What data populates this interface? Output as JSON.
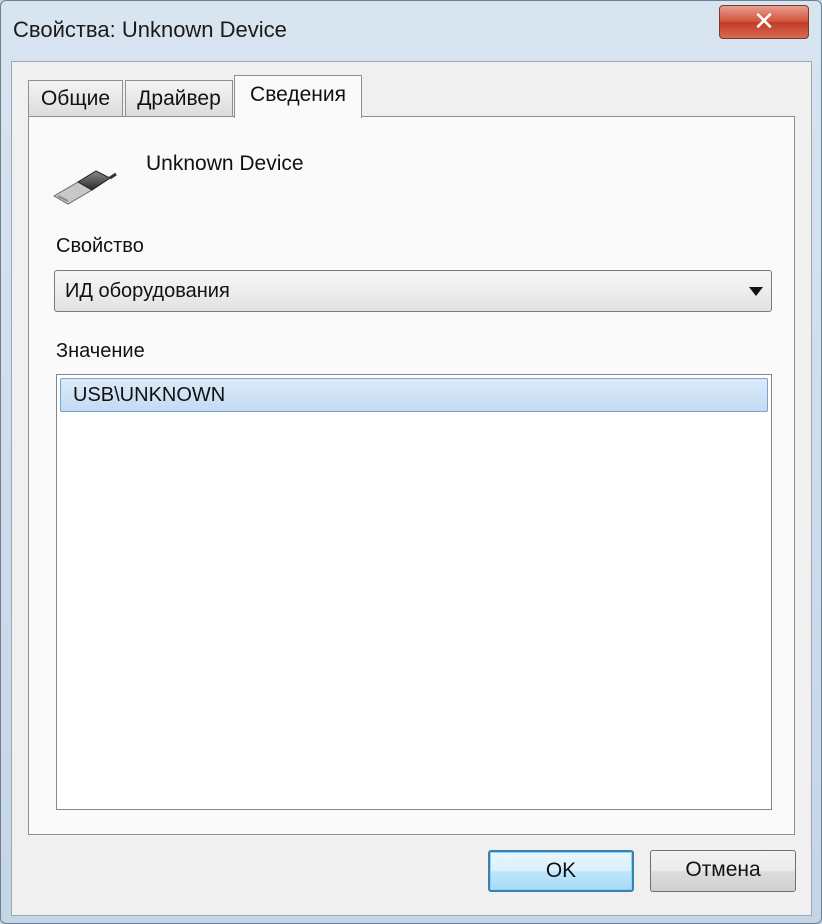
{
  "window": {
    "title": "Свойства: Unknown Device",
    "close_label": "✕"
  },
  "tabs": [
    {
      "label": "Общие"
    },
    {
      "label": "Драйвер"
    },
    {
      "label": "Сведения",
      "active": true
    }
  ],
  "device": {
    "name": "Unknown Device",
    "icon": "usb-plug-icon"
  },
  "property": {
    "label": "Свойство",
    "selected": "ИД оборудования"
  },
  "value": {
    "label": "Значение",
    "items": [
      "USB\\UNKNOWN"
    ]
  },
  "buttons": {
    "ok": "OK",
    "cancel": "Отмена"
  },
  "colors": {
    "selection": "#c4dbf3",
    "close": "#c7432c"
  }
}
